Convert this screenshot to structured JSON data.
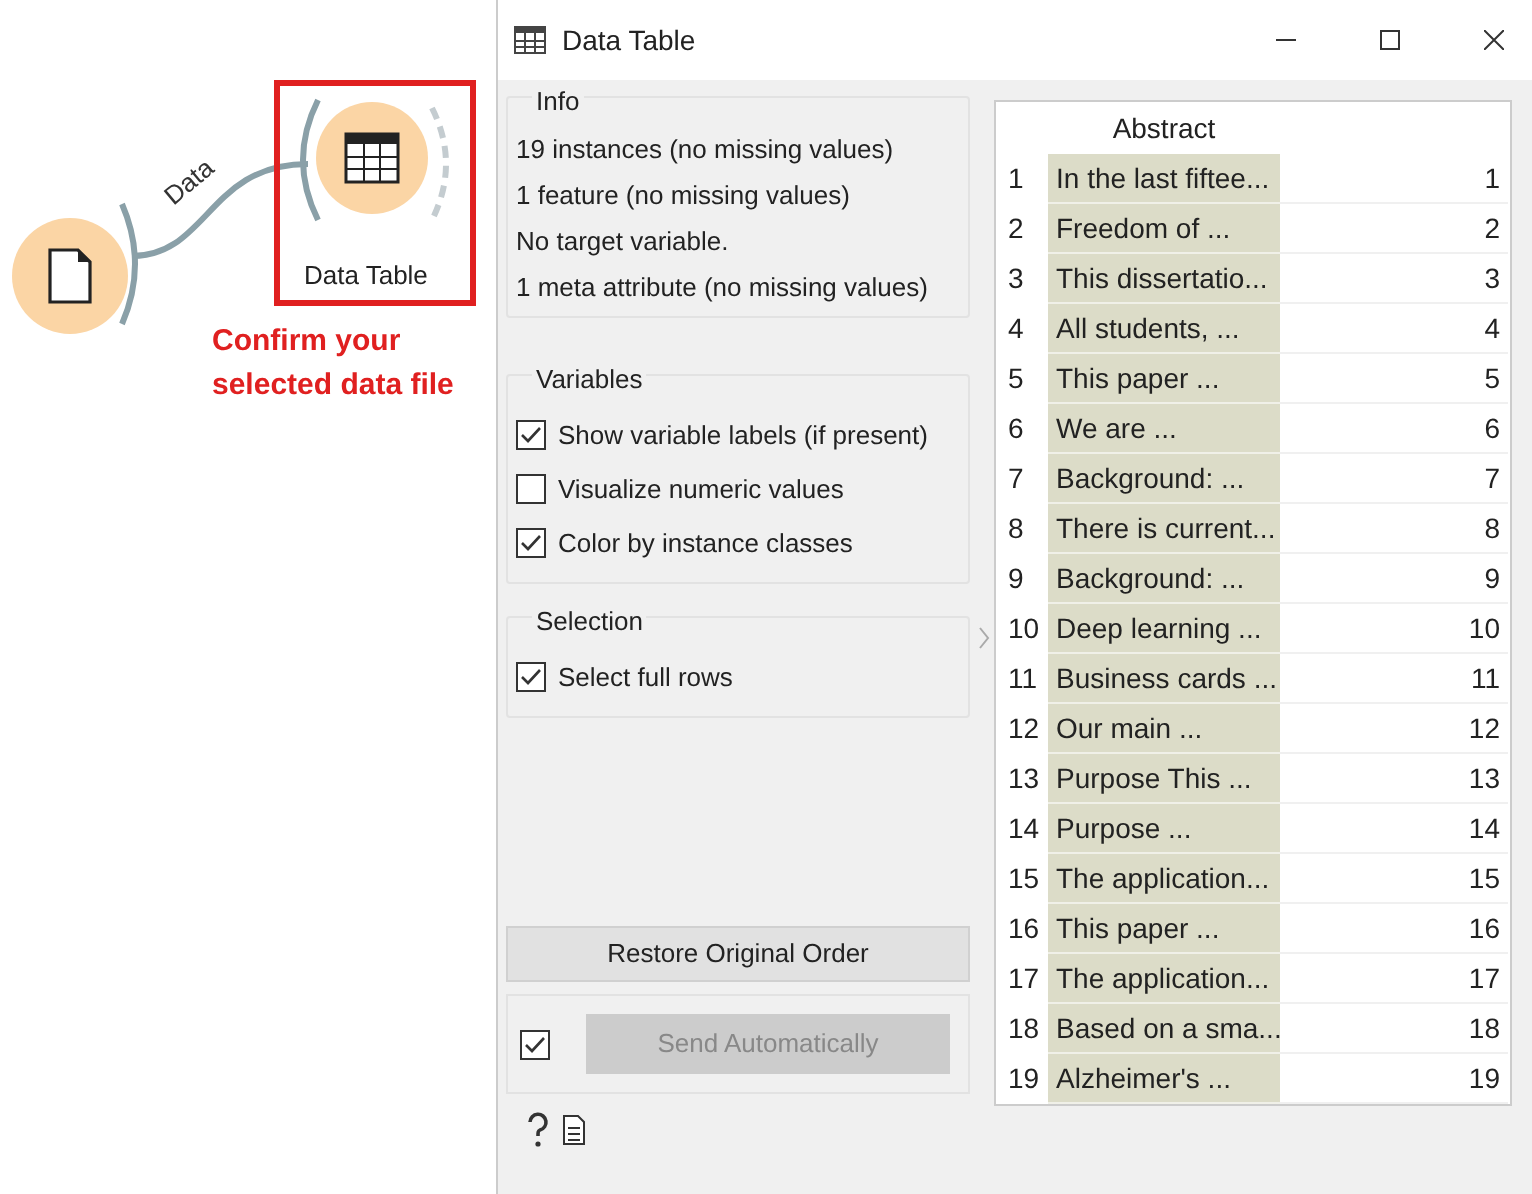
{
  "canvas": {
    "link_label": "Data",
    "node_label": "Data Table",
    "annotation": "Confirm your selected data file"
  },
  "window": {
    "title": "Data Table"
  },
  "info": {
    "title": "Info",
    "lines": [
      "19 instances (no missing values)",
      "1 feature (no missing values)",
      "No target variable.",
      "1 meta attribute (no missing values)"
    ]
  },
  "variables": {
    "title": "Variables",
    "options": [
      {
        "label": "Show variable labels (if present)",
        "checked": true
      },
      {
        "label": "Visualize numeric values",
        "checked": false
      },
      {
        "label": "Color by instance classes",
        "checked": true
      }
    ]
  },
  "selection": {
    "title": "Selection",
    "options": [
      {
        "label": "Select full rows",
        "checked": true
      }
    ]
  },
  "restore_button": "Restore Original Order",
  "send": {
    "checked": true,
    "label": "Send Automatically",
    "disabled": true
  },
  "table": {
    "columns": [
      "",
      "Abstract",
      ""
    ],
    "rows": [
      [
        "1",
        "In the last fiftee...",
        "1"
      ],
      [
        "2",
        "Freedom of ...",
        "2"
      ],
      [
        "3",
        "This dissertatio...",
        "3"
      ],
      [
        "4",
        "All students, ...",
        "4"
      ],
      [
        "5",
        "This paper ...",
        "5"
      ],
      [
        "6",
        "We are ...",
        "6"
      ],
      [
        "7",
        "Background: ...",
        "7"
      ],
      [
        "8",
        "There is current...",
        "8"
      ],
      [
        "9",
        "Background: ...",
        "9"
      ],
      [
        "10",
        "Deep learning ...",
        "10"
      ],
      [
        "11",
        "Business cards ...",
        "11"
      ],
      [
        "12",
        "Our main ...",
        "12"
      ],
      [
        "13",
        "Purpose This ...",
        "13"
      ],
      [
        "14",
        "Purpose ...",
        "14"
      ],
      [
        "15",
        "The application...",
        "15"
      ],
      [
        "16",
        "This paper ...",
        "16"
      ],
      [
        "17",
        "The application...",
        "17"
      ],
      [
        "18",
        "Based on a sma...",
        "18"
      ],
      [
        "19",
        "Alzheimer's ...",
        "19"
      ]
    ]
  }
}
